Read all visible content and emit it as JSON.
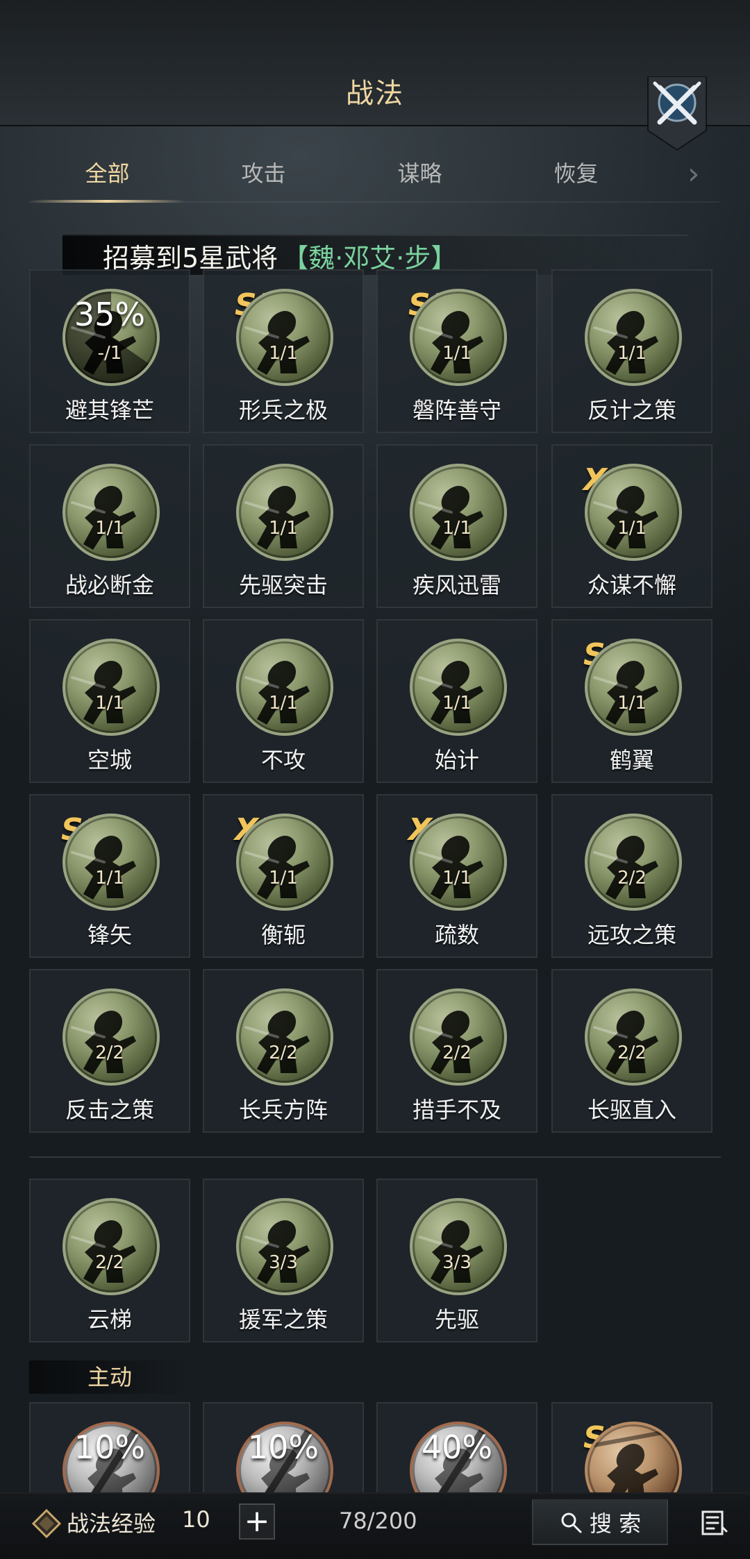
{
  "header": {
    "title": "战法"
  },
  "tabs": [
    {
      "label": "全部",
      "active": true
    },
    {
      "label": "攻击",
      "active": false
    },
    {
      "label": "谋略",
      "active": false
    },
    {
      "label": "恢复",
      "active": false
    }
  ],
  "banner": {
    "prefix": "招募到5星武将",
    "hero": "【魏·邓艾·步】"
  },
  "grid_top": [
    {
      "name": "避其锋芒",
      "progress_text": "35%",
      "count": "-/1",
      "badge": "",
      "dimmed": true
    },
    {
      "name": "形兵之极",
      "progress_text": "",
      "count": "1/1",
      "badge": "S3",
      "dimmed": false
    },
    {
      "name": "磐阵善守",
      "progress_text": "",
      "count": "1/1",
      "badge": "S3",
      "dimmed": false
    },
    {
      "name": "反计之策",
      "progress_text": "",
      "count": "1/1",
      "badge": "",
      "dimmed": false
    },
    {
      "name": "战必断金",
      "progress_text": "",
      "count": "1/1",
      "badge": "",
      "dimmed": false
    },
    {
      "name": "先驱突击",
      "progress_text": "",
      "count": "1/1",
      "badge": "",
      "dimmed": false
    },
    {
      "name": "疾风迅雷",
      "progress_text": "",
      "count": "1/1",
      "badge": "",
      "dimmed": false
    },
    {
      "name": "众谋不懈",
      "progress_text": "",
      "count": "1/1",
      "badge": "XP",
      "dimmed": false
    },
    {
      "name": "空城",
      "progress_text": "",
      "count": "1/1",
      "badge": "",
      "dimmed": false
    },
    {
      "name": "不攻",
      "progress_text": "",
      "count": "1/1",
      "badge": "",
      "dimmed": false
    },
    {
      "name": "始计",
      "progress_text": "",
      "count": "1/1",
      "badge": "",
      "dimmed": false
    },
    {
      "name": "鹤翼",
      "progress_text": "",
      "count": "1/1",
      "badge": "S2",
      "dimmed": false
    },
    {
      "name": "锋矢",
      "progress_text": "",
      "count": "1/1",
      "badge": "S2",
      "dimmed": false
    },
    {
      "name": "衡轭",
      "progress_text": "",
      "count": "1/1",
      "badge": "XP",
      "dimmed": false
    },
    {
      "name": "疏数",
      "progress_text": "",
      "count": "1/1",
      "badge": "XP",
      "dimmed": false
    },
    {
      "name": "远攻之策",
      "progress_text": "",
      "count": "2/2",
      "badge": "",
      "dimmed": false
    },
    {
      "name": "反击之策",
      "progress_text": "",
      "count": "2/2",
      "badge": "",
      "dimmed": false
    },
    {
      "name": "长兵方阵",
      "progress_text": "",
      "count": "2/2",
      "badge": "",
      "dimmed": false
    },
    {
      "name": "措手不及",
      "progress_text": "",
      "count": "2/2",
      "badge": "",
      "dimmed": false
    },
    {
      "name": "长驱直入",
      "progress_text": "",
      "count": "2/2",
      "badge": "",
      "dimmed": false
    }
  ],
  "grid_mid": [
    {
      "name": "云梯",
      "count": "2/2"
    },
    {
      "name": "援军之策",
      "count": "3/3"
    },
    {
      "name": "先驱",
      "count": "3/3"
    }
  ],
  "section": {
    "label": "主动"
  },
  "grid_bottom": [
    {
      "progress_text": "10%",
      "badge": ""
    },
    {
      "progress_text": "10%",
      "badge": ""
    },
    {
      "progress_text": "40%",
      "badge": ""
    },
    {
      "progress_text": "",
      "badge": "S3"
    }
  ],
  "bottom_bar": {
    "exp_label": "战法经验",
    "exp_value": "10",
    "plus": "+",
    "progress": "78/200",
    "search_label": "搜 索"
  },
  "icons": {
    "close_icon": "crossed-swords-icon",
    "next_icon": "chevron-right-icon",
    "exp_icon": "exp-token-icon",
    "search_icon": "magnifier-icon",
    "list_icon": "list-icon"
  }
}
